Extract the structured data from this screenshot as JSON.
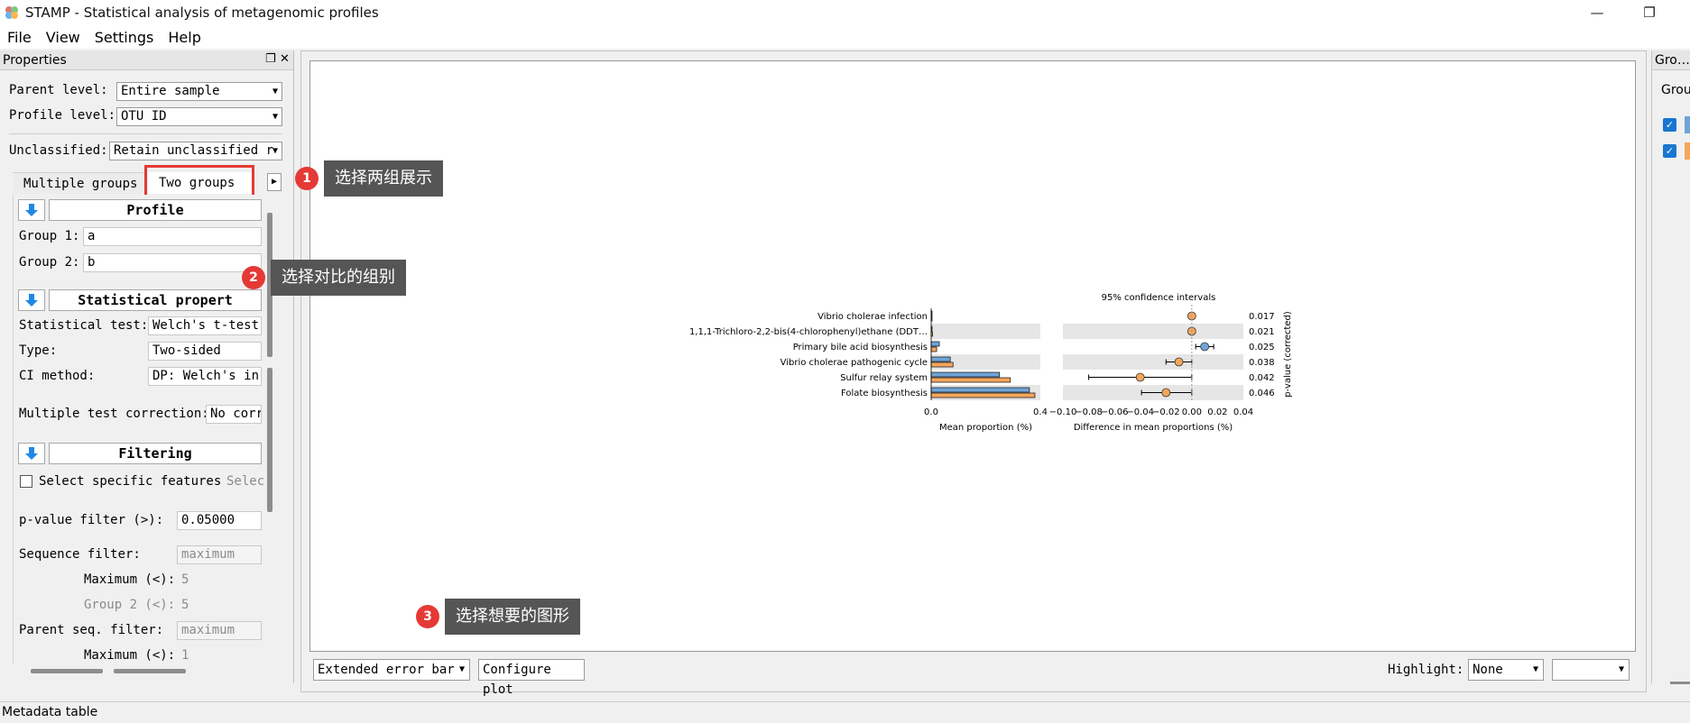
{
  "window": {
    "title": "STAMP - Statistical analysis of metagenomic profiles"
  },
  "menu": [
    "File",
    "View",
    "Settings",
    "Help"
  ],
  "properties": {
    "title": "Properties",
    "parent_level_label": "Parent level:",
    "parent_level_value": "Entire sample",
    "profile_level_label": "Profile level:",
    "profile_level_value": "OTU ID",
    "unclassified_label": "Unclassified:",
    "unclassified_value": "Retain unclassified r",
    "tabs": [
      "Multiple groups",
      "Two groups"
    ],
    "profile": {
      "title": "Profile",
      "group1_label": "Group 1:",
      "group1_value": "a",
      "group2_label": "Group 2:",
      "group2_value": "b"
    },
    "statistical": {
      "title": "Statistical propert",
      "test_label": "Statistical test:",
      "test_value": "Welch's t-test",
      "type_label": "Type:",
      "type_value": "Two-sided",
      "ci_label": "CI method:",
      "ci_value": "DP: Welch's in",
      "correction_label": "Multiple test correction:",
      "correction_value": "No corr"
    },
    "filtering": {
      "title": "Filtering",
      "specific_label": "Select specific features",
      "specific_btn": "Selec",
      "pvalue_label": "p-value filter (>):",
      "pvalue_value": "0.05000",
      "seq_label": "Sequence filter:",
      "seq_value": "maximum",
      "max_label": "Maximum (<):",
      "max_value": "5",
      "group2_label": "Group 2 (<):",
      "group2_value": "5",
      "parent_label": "Parent seq. filter:",
      "parent_value": "maximum",
      "parent_max_label": "Maximum (<):",
      "parent_max_value": "1"
    }
  },
  "bottom": {
    "plot_type": "Extended error bar",
    "configure": "Configure plot",
    "highlight_label": "Highlight:",
    "highlight_value": "None",
    "highlight_extra": ""
  },
  "groups_panel": {
    "title": "Gro…",
    "label": "Grou",
    "colors": [
      "#6ea4d8",
      "#f5a65b"
    ]
  },
  "statusbar": "Metadata table",
  "callouts": [
    {
      "num": "1",
      "text": "选择两组展示"
    },
    {
      "num": "2",
      "text": "选择对比的组别"
    },
    {
      "num": "3",
      "text": "选择想要的图形"
    }
  ],
  "chart_data": {
    "type": "extended-error-bar",
    "ci_title": "95% confidence intervals",
    "features": [
      "Vibrio cholerae infection",
      "1,1,1-Trichloro-2,2-bis(4-chlorophenyl)ethane (DDT…",
      "Primary bile acid biosynthesis",
      "Vibrio cholerae pathogenic cycle",
      "Sulfur relay system",
      "Folate biosynthesis"
    ],
    "pvalues": [
      "0.017",
      "0.021",
      "0.025",
      "0.038",
      "0.042",
      "0.046"
    ],
    "series": [
      {
        "name": "a",
        "color": "#6ea4d8",
        "values": [
          0.002,
          0.003,
          0.03,
          0.07,
          0.25,
          0.36
        ]
      },
      {
        "name": "b",
        "color": "#f5a65b",
        "values": [
          0.001,
          0.005,
          0.02,
          0.08,
          0.29,
          0.38
        ]
      }
    ],
    "diff": [
      {
        "mean": 0.0,
        "lo": -0.002,
        "hi": 0.002,
        "color": "#f5a65b"
      },
      {
        "mean": 0.0,
        "lo": -0.002,
        "hi": 0.002,
        "color": "#f5a65b"
      },
      {
        "mean": 0.01,
        "lo": 0.003,
        "hi": 0.017,
        "color": "#6ea4d8"
      },
      {
        "mean": -0.01,
        "lo": -0.02,
        "hi": 0.0,
        "color": "#f5a65b"
      },
      {
        "mean": -0.04,
        "lo": -0.08,
        "hi": 0.0,
        "color": "#f5a65b"
      },
      {
        "mean": -0.02,
        "lo": -0.039,
        "hi": 0.0,
        "color": "#f5a65b"
      }
    ],
    "xlabel_left": "Mean proportion (%)",
    "xticks_left": [
      "0.0",
      "0.4"
    ],
    "xlim_left": [
      0,
      0.4
    ],
    "xlabel_right": "Difference in mean proportions (%)",
    "xticks_right": [
      "−0.10",
      "−0.08",
      "−0.06",
      "−0.04",
      "−0.02",
      "0.00",
      "0.02",
      "0.04"
    ],
    "xlim_right": [
      -0.1,
      0.04
    ],
    "ylabel_right": "p-value (corrected)"
  }
}
